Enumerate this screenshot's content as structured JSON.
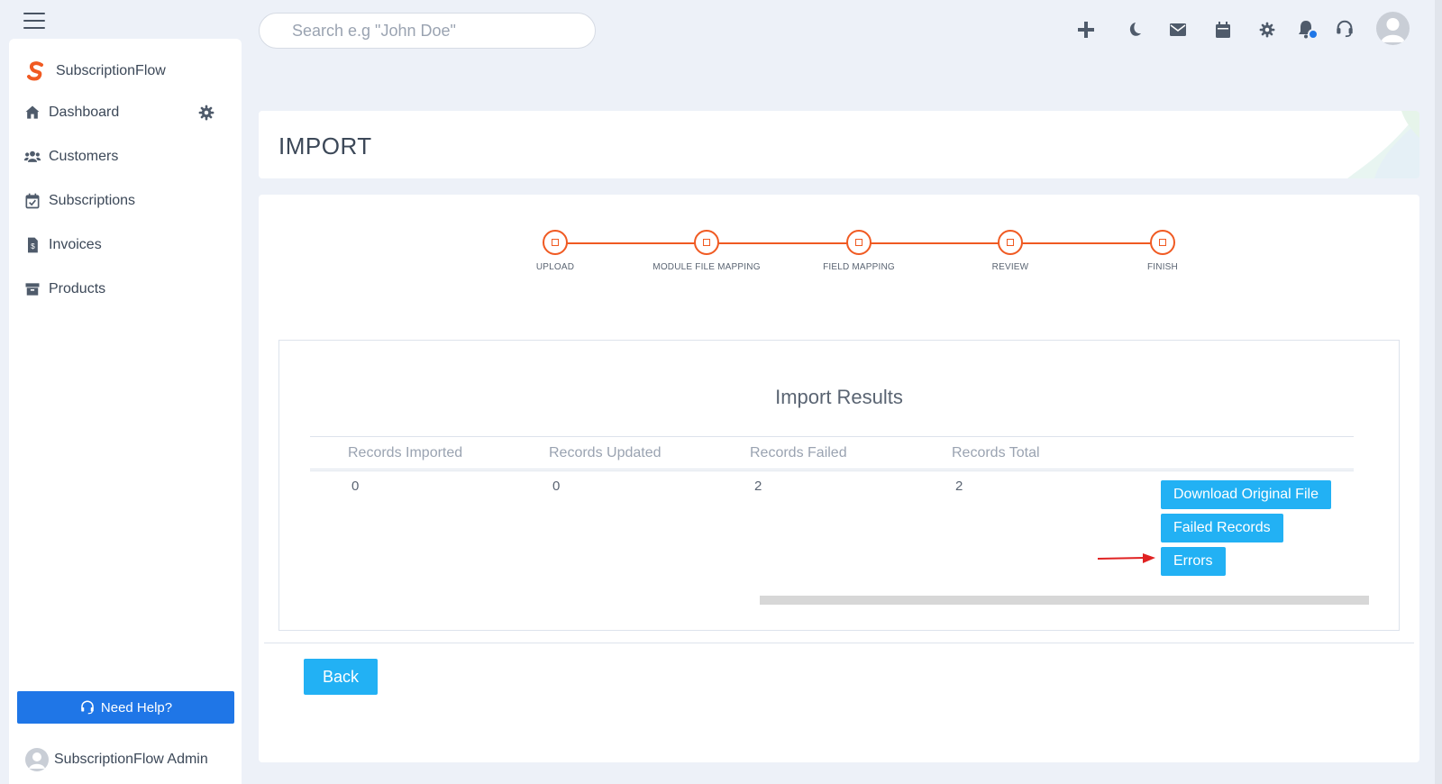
{
  "header": {
    "search_placeholder": "Search e.g \"John Doe\"",
    "icons": [
      "plus-icon",
      "moon-icon",
      "mail-icon",
      "calendar-icon",
      "gear-icon",
      "bell-icon",
      "headset-icon",
      "user-avatar"
    ]
  },
  "sidebar": {
    "brand": "SubscriptionFlow",
    "items": [
      {
        "label": "Dashboard",
        "icon": "home-icon"
      },
      {
        "label": "Customers",
        "icon": "users-icon"
      },
      {
        "label": "Subscriptions",
        "icon": "calendar-check-icon"
      },
      {
        "label": "Invoices",
        "icon": "invoice-icon"
      },
      {
        "label": "Products",
        "icon": "archive-icon"
      }
    ],
    "help_label": "Need Help?",
    "admin_name": "SubscriptionFlow Admin"
  },
  "page": {
    "title": "IMPORT"
  },
  "stepper": {
    "steps": [
      "UPLOAD",
      "MODULE FILE MAPPING",
      "FIELD MAPPING",
      "REVIEW",
      "FINISH"
    ]
  },
  "results": {
    "title": "Import Results",
    "columns": [
      "Records Imported",
      "Records Updated",
      "Records Failed",
      "Records Total"
    ],
    "row": [
      "0",
      "0",
      "2",
      "2"
    ],
    "buttons": {
      "download": "Download Original File",
      "failed": "Failed Records",
      "errors": "Errors"
    }
  },
  "footer": {
    "back_label": "Back"
  },
  "colors": {
    "accent_orange": "#f05a22",
    "button_blue": "#22b1f4",
    "help_blue": "#1f76e7",
    "background": "#edf1f8"
  }
}
